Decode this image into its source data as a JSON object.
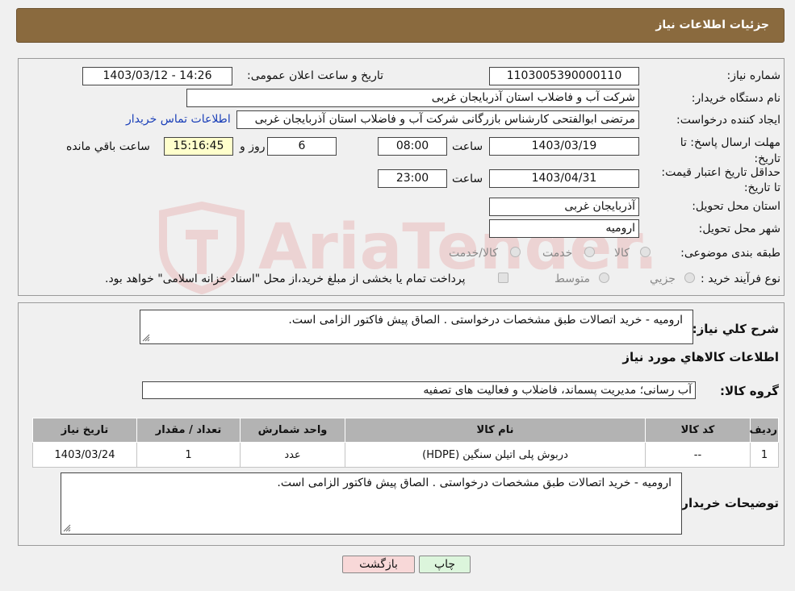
{
  "header": {
    "title": "جزئیات اطلاعات نیاز"
  },
  "details": {
    "need_number_label": "شماره نیاز:",
    "need_number": "1103005390000110",
    "announce_label": "تاریخ و ساعت اعلان عمومی:",
    "announce_value": "1403/03/12 - 14:26",
    "buyer_org_label": "نام دستگاه خریدار:",
    "buyer_org": "شرکت آب و فاضلاب استان آذربایجان غربی",
    "creator_label": "ایجاد کننده درخواست:",
    "creator": "مرتضی ابوالفتحی کارشناس بازرگانی شرکت آب و فاضلاب استان آذربایجان غربی",
    "contact_link": "اطلاعات تماس خریدار",
    "reply_deadline_label": "مهلت ارسال پاسخ: تا تاریخ:",
    "reply_date": "1403/03/19",
    "time_label": "ساعت",
    "reply_time": "08:00",
    "days_value": "6",
    "days_label": "روز و",
    "remaining_time": "15:16:45",
    "remaining_label": "ساعت باقي مانده",
    "price_validity_label": "حداقل تاریخ اعتبار قیمت: تا تاریخ:",
    "price_date": "1403/04/31",
    "price_time_label": "ساعت",
    "price_time": "23:00",
    "province_label": "استان محل تحویل:",
    "province": "آذربایجان غربی",
    "city_label": "شهر محل تحویل:",
    "city": "ارومیه",
    "category_label": "طبقه بندی موضوعی:",
    "category_options": [
      "کالا",
      "خدمت",
      "کالا/خدمت"
    ],
    "process_label": "نوع فرآیند خرید :",
    "process_options": [
      "جزیي",
      "متوسط"
    ],
    "payment_note": "پرداخت تمام یا بخشی از مبلغ خرید،از محل \"اسناد خزانه اسلامی\" خواهد بود."
  },
  "summary": {
    "description_label": "شرح كلي نياز:",
    "description": "ارومیه - خرید  اتصالات طبق مشخصات درخواستی . الصاق پیش فاکتور الزامی است.",
    "goods_info_title": "اطلاعات كالاهاي مورد نياز",
    "goods_group_label": "گروه كالا:",
    "goods_group": "آب رسانی؛ مدیریت پسماند، فاضلاب و فعالیت های تصفیه",
    "table": {
      "headers": [
        "ردیف",
        "کد کالا",
        "نام کالا",
        "واحد شمارش",
        "تعداد / مقدار",
        "تاریخ نیاز"
      ],
      "rows": [
        [
          "1",
          "--",
          "دربوش پلی اتیلن سنگین (HDPE)",
          "عدد",
          "1",
          "1403/03/24"
        ]
      ]
    },
    "buyer_notes_label": "توضیحات خریدار:",
    "buyer_notes": "ارومیه - خرید  اتصالات طبق مشخصات درخواستی . الصاق پیش فاکتور الزامی است."
  },
  "buttons": {
    "print": "چاپ",
    "back": "بازگشت"
  },
  "watermark": {
    "text": "AriaTender.neT"
  },
  "colors": {
    "header_bg": "#8a6a3e",
    "link": "#1a3fb8",
    "back_btn": "#f8d8d8",
    "print_btn": "#dcf5dc"
  }
}
